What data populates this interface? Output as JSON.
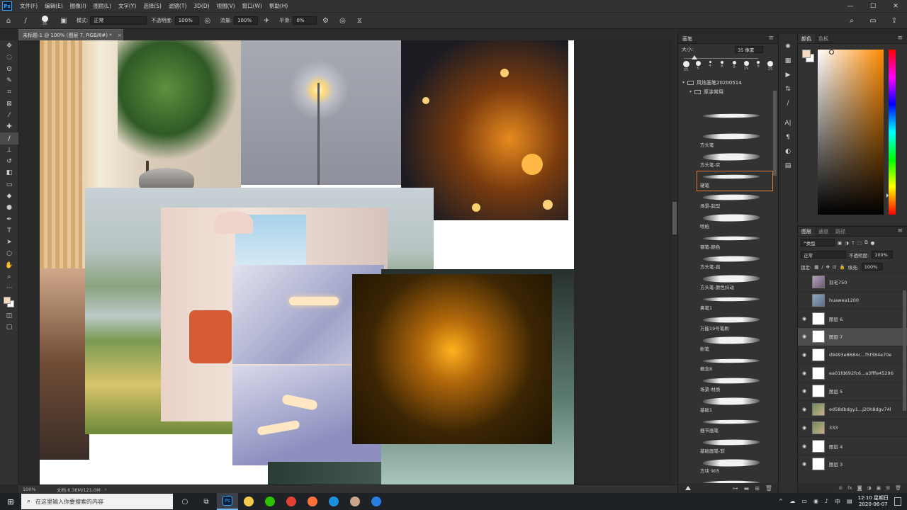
{
  "menubar": {
    "logo": "Ps",
    "items": [
      "文件(F)",
      "编辑(E)",
      "图像(I)",
      "图层(L)",
      "文字(Y)",
      "选择(S)",
      "滤镜(T)",
      "3D(D)",
      "视图(V)",
      "窗口(W)",
      "帮助(H)"
    ],
    "window_controls": [
      "—",
      "☐",
      "✕"
    ]
  },
  "options": {
    "brush_size": "35",
    "mode_label": "模式:",
    "mode_value": "正常",
    "opacity_label": "不透明度:",
    "opacity_value": "100%",
    "flow_label": "流量:",
    "flow_value": "100%",
    "smoothing_label": "平滑:",
    "smoothing_value": "0%"
  },
  "document": {
    "tab_title": "未标题-1 @ 100% (图层 7, RGB/8#) *",
    "close": "×",
    "watermark": "@中国美"
  },
  "status": {
    "zoom": "100%",
    "doc_size": "文档:6.36M/121.0M",
    "arrow": "›"
  },
  "toolbar": {
    "tools": [
      {
        "name": "move-tool",
        "glyph": "✥"
      },
      {
        "name": "marquee-tool",
        "glyph": "◌"
      },
      {
        "name": "lasso-tool",
        "glyph": "ʘ"
      },
      {
        "name": "quick-select-tool",
        "glyph": "✎"
      },
      {
        "name": "crop-tool",
        "glyph": "⌗"
      },
      {
        "name": "frame-tool",
        "glyph": "⊠"
      },
      {
        "name": "eyedropper-tool",
        "glyph": "⁄"
      },
      {
        "name": "healing-tool",
        "glyph": "✚"
      },
      {
        "name": "brush-tool",
        "glyph": "/"
      },
      {
        "name": "stamp-tool",
        "glyph": "⊥"
      },
      {
        "name": "history-brush-tool",
        "glyph": "↺"
      },
      {
        "name": "eraser-tool",
        "glyph": "◧"
      },
      {
        "name": "gradient-tool",
        "glyph": "▭"
      },
      {
        "name": "blur-tool",
        "glyph": "◆"
      },
      {
        "name": "dodge-tool",
        "glyph": "●"
      },
      {
        "name": "pen-tool",
        "glyph": "✒"
      },
      {
        "name": "type-tool",
        "glyph": "T"
      },
      {
        "name": "path-select-tool",
        "glyph": "➤"
      },
      {
        "name": "shape-tool",
        "glyph": "○"
      },
      {
        "name": "hand-tool",
        "glyph": "✋"
      },
      {
        "name": "zoom-tool",
        "glyph": "⌕"
      },
      {
        "name": "more-tools",
        "glyph": "···"
      }
    ],
    "fg_color": "#f5dcc0",
    "bg_color": "#ffffff"
  },
  "brush_panel": {
    "title": "画笔",
    "menu_glyph": "≡",
    "size_label": "大小:",
    "size_value": "35 像素",
    "size_level": 0.12,
    "presets": [
      {
        "label": "35",
        "d": 9
      },
      {
        "label": "5",
        "d": 7
      },
      {
        "label": "4",
        "d": 3
      },
      {
        "label": "6",
        "d": 4
      },
      {
        "label": "9",
        "d": 5
      },
      {
        "label": "19",
        "d": 7
      },
      {
        "label": "9",
        "d": 4
      },
      {
        "label": "25",
        "d": 8
      }
    ],
    "group": "风炫画笔20200514",
    "subgroup": "厚涂常用",
    "brushes": [
      "",
      "方头笔",
      "方头笔-实",
      "硬笔",
      "场景-起型",
      "喷枪",
      "钢笔-颜色",
      "方头笔-扁",
      "方头笔-颜色抖动",
      "鼻笔1",
      "万能19号笔刷",
      "粉笔",
      "概念8",
      "场景-材质",
      "基础1",
      "细节画笔",
      "基础画笔-软",
      "方块 905",
      "我最爱"
    ],
    "selected_index": 3
  },
  "color_panel": {
    "tabs": [
      "颜色",
      "色板"
    ],
    "menu_glyph": "≡",
    "fg_color": "#f5dcc0",
    "bg_color": "#ffffff"
  },
  "layers_panel": {
    "tabs": [
      "图层",
      "通道",
      "路径"
    ],
    "menu_glyph": "≡",
    "filter_label": "类型",
    "blend_mode": "正常",
    "opacity_label": "不透明度:",
    "opacity_value": "100%",
    "lock_label": "锁定:",
    "fill_label": "填充:",
    "fill_value": "100%",
    "layers": [
      {
        "name": "羽毛750",
        "visible": false,
        "thumb": "img"
      },
      {
        "name": "huawea1200",
        "visible": false,
        "thumb": "img2"
      },
      {
        "name": "图层 6",
        "visible": true,
        "thumb": "blank"
      },
      {
        "name": "图层 7",
        "visible": true,
        "thumb": "blank"
      },
      {
        "name": "d9493e8684c...f5f384e70e",
        "visible": true,
        "thumb": "blank"
      },
      {
        "name": "ea01fd692fc6...a3fffe45296",
        "visible": true,
        "thumb": "blank"
      },
      {
        "name": "图层 5",
        "visible": true,
        "thumb": "blank"
      },
      {
        "name": "ed58dbdgy1...j20h8dgv74l",
        "visible": true,
        "thumb": "img3"
      },
      {
        "name": "333",
        "visible": true,
        "thumb": "img3"
      },
      {
        "name": "图层 4",
        "visible": true,
        "thumb": "blank"
      },
      {
        "name": "图层 3",
        "visible": true,
        "thumb": "blank"
      }
    ],
    "selected_index": 3,
    "footer_icons": [
      "⊘",
      "fx",
      "◙",
      "◑",
      "▣",
      "⊞",
      "🗑"
    ]
  },
  "taskbar": {
    "search_placeholder": "在这里输入你要搜索的内容",
    "apps": [
      {
        "name": "cortana",
        "color": "#1e2227",
        "glyph": "○"
      },
      {
        "name": "task-view",
        "color": "#1e2227",
        "glyph": "⧉"
      },
      {
        "name": "photoshop",
        "color": "#0c1d38",
        "glyph": "Ps"
      },
      {
        "name": "file-explorer",
        "color": "#f2c94c",
        "glyph": ""
      },
      {
        "name": "wechat",
        "color": "#2dc100",
        "glyph": ""
      },
      {
        "name": "chrome",
        "color": "#e34133",
        "glyph": ""
      },
      {
        "name": "firefox",
        "color": "#ff7139",
        "glyph": ""
      },
      {
        "name": "edge",
        "color": "#1c8fe0",
        "glyph": ""
      },
      {
        "name": "app-avatar",
        "color": "#c9a48a",
        "glyph": ""
      },
      {
        "name": "app-blue",
        "color": "#2a7de1",
        "glyph": ""
      }
    ],
    "time": "12:10 星期日",
    "date": "2020-06-07",
    "tray_icons": [
      "^",
      "☁",
      "▭",
      "◉",
      "♪",
      "中",
      "▤"
    ]
  }
}
